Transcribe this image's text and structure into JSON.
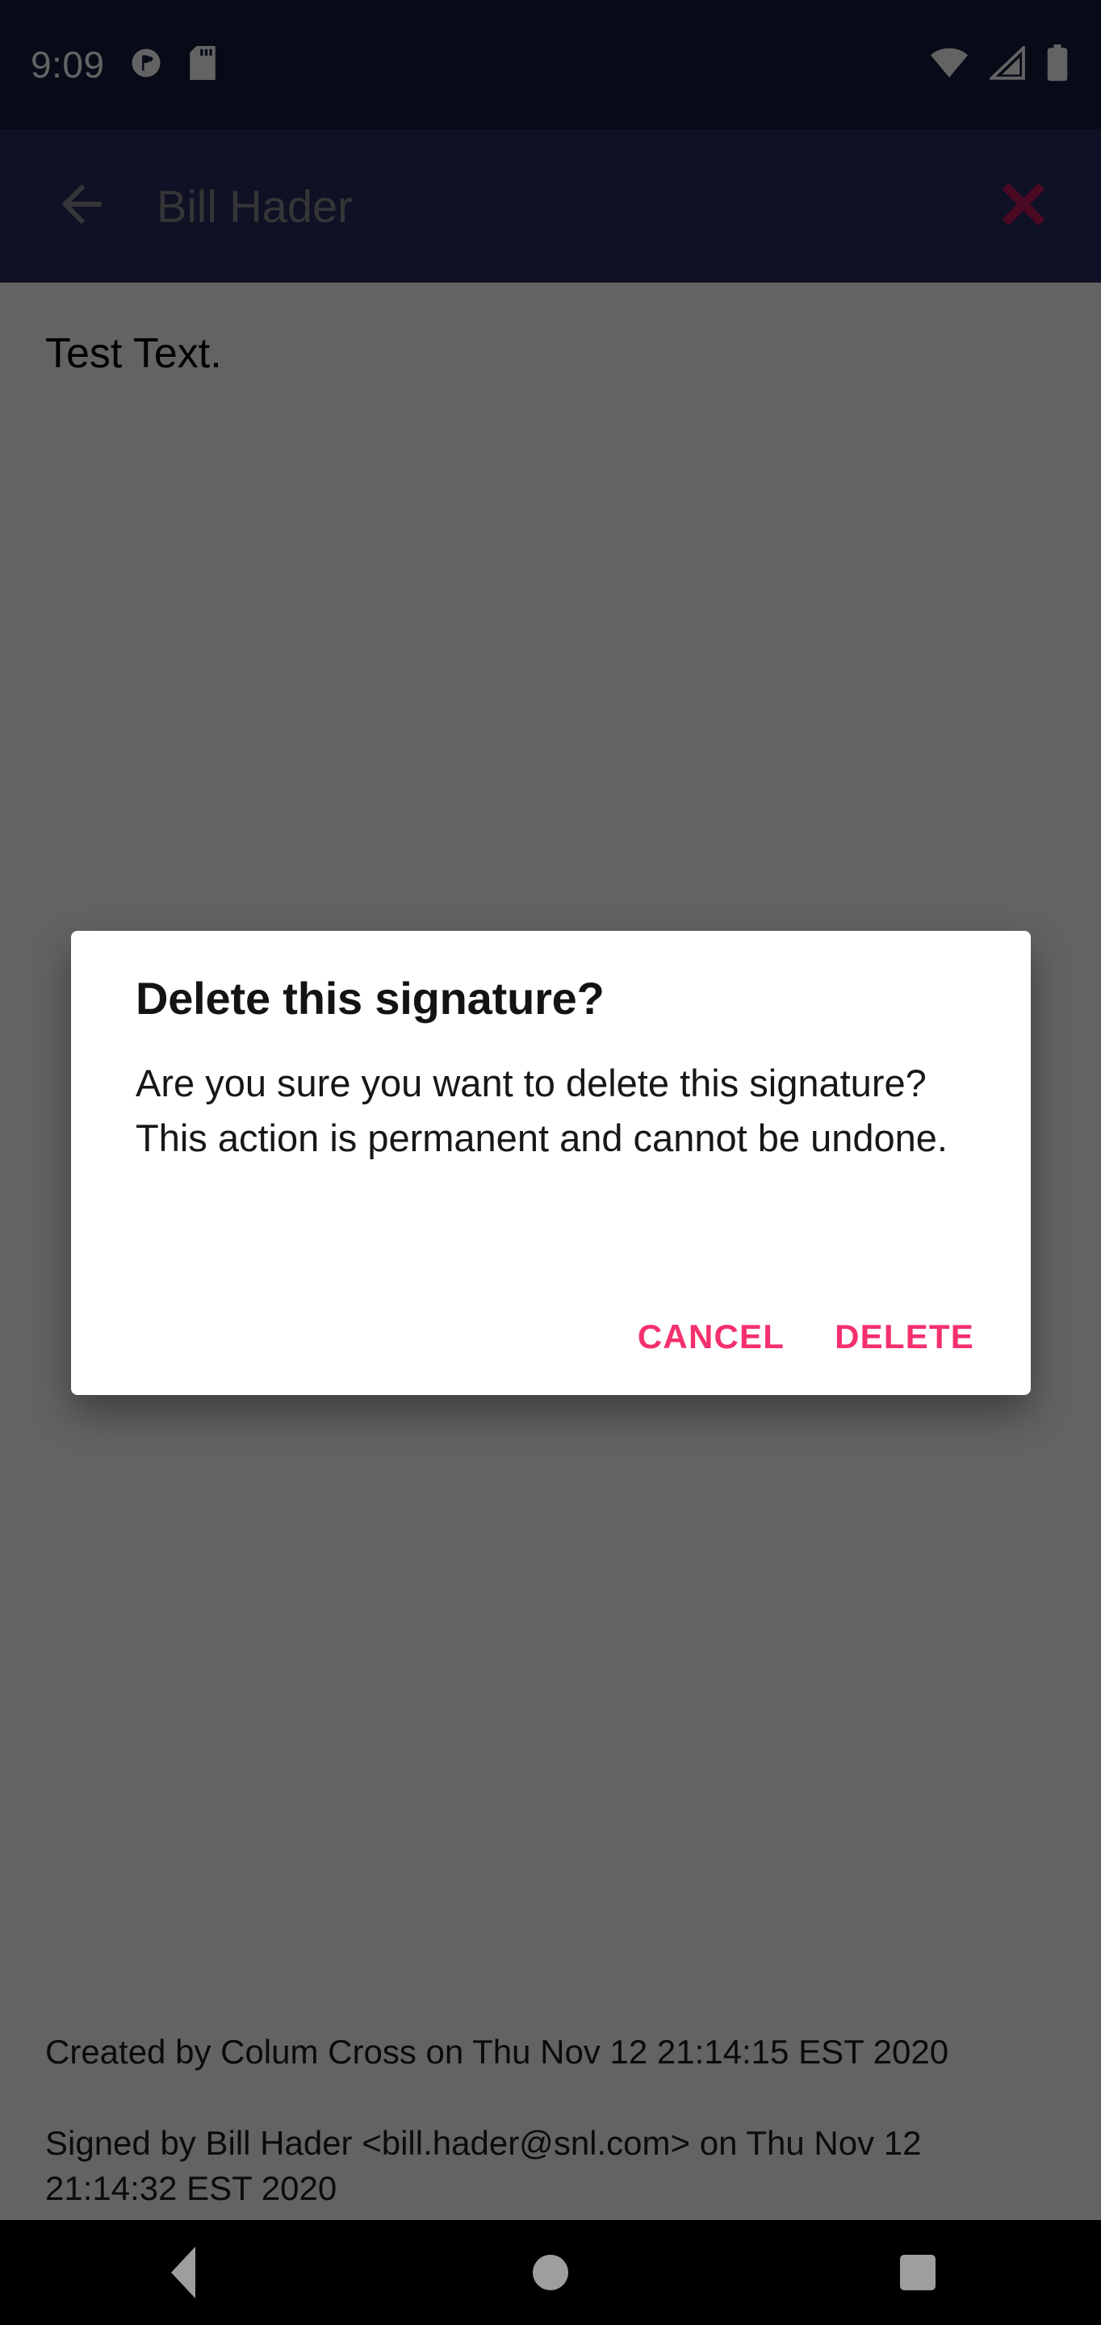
{
  "status_bar": {
    "time": "9:09",
    "icons": [
      "app-notification-icon",
      "sd-card-icon",
      "wifi-icon",
      "cellular-signal-icon",
      "battery-icon"
    ],
    "background_color": "#131A3C"
  },
  "app_bar": {
    "title": "Bill Hader",
    "back_icon": "back-arrow-icon",
    "action_icon": "delete-x-icon",
    "background_color": "#282E5D",
    "title_color": "#8A8A8E",
    "action_color": "#C2185B"
  },
  "content": {
    "body_text": "Test Text.",
    "meta": {
      "created": "Created by Colum Cross on Thu Nov 12 21:14:15 EST 2020",
      "signed": "Signed by Bill Hader <bill.hader@snl.com> on Thu Nov 12 21:14:32 EST 2020"
    }
  },
  "dialog": {
    "title": "Delete this signature?",
    "message": "Are you sure you want to delete this signature? This action is permanent and cannot be undone.",
    "cancel_label": "CANCEL",
    "confirm_label": "DELETE",
    "accent_color": "#F4306D",
    "background_color": "#FFFFFF"
  },
  "nav_bar": {
    "back_label": "Back",
    "home_label": "Home",
    "recents_label": "Recents",
    "background_color": "#000000",
    "icon_color": "#9E9E9E"
  }
}
